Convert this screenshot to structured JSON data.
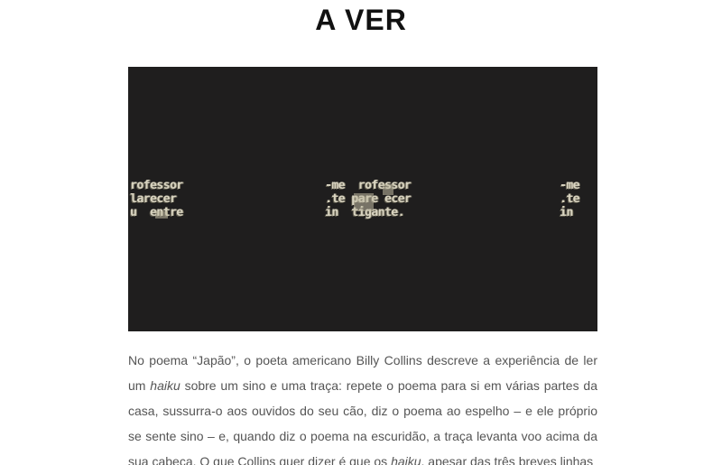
{
  "title": "A VER",
  "video": {
    "overlay_left": "rofessor\nlarecer\nu  entre",
    "overlay_center": "-me  rofessor\n.te pare ecer\nin  tigante.",
    "overlay_right": "-me\n.te\nin"
  },
  "article": {
    "p1_part1": "No poema “Japão”, o poeta americano Billy Collins descreve a experiência de ler um ",
    "p1_em1": "haiku",
    "p1_part2": " sobre um sino e uma traça: repete o poema para si em várias partes da casa, sussurra-o aos ouvidos do seu cão, diz o poema ao espelho – e ele próprio se sente sino – e, quando diz o poema na escuridão, a traça levanta voo acima da sua cabeça. O que Collins quer dizer é que os ",
    "p1_em2": "haiku",
    "p1_part3": ", apesar das três breves linhas"
  }
}
